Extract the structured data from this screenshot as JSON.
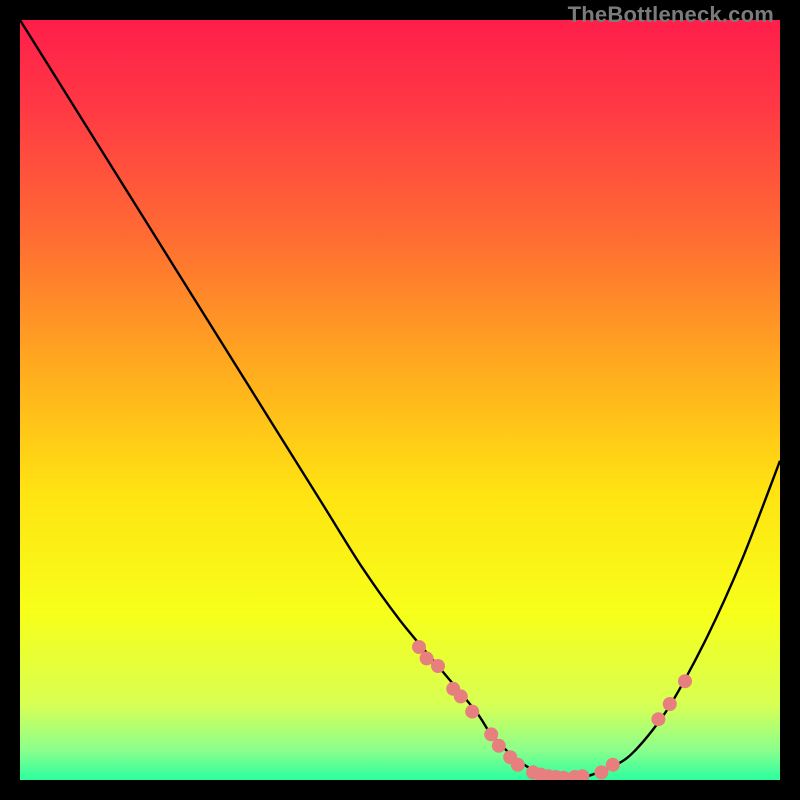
{
  "watermark": "TheBottleneck.com",
  "colors": {
    "gradient_stops": [
      {
        "offset": 0.0,
        "color": "#ff1e4b"
      },
      {
        "offset": 0.12,
        "color": "#ff3a44"
      },
      {
        "offset": 0.28,
        "color": "#ff6a33"
      },
      {
        "offset": 0.45,
        "color": "#ffa81f"
      },
      {
        "offset": 0.62,
        "color": "#ffe312"
      },
      {
        "offset": 0.78,
        "color": "#f7ff1a"
      },
      {
        "offset": 0.9,
        "color": "#d8ff53"
      },
      {
        "offset": 0.96,
        "color": "#8cff8c"
      },
      {
        "offset": 1.0,
        "color": "#2bff9e"
      }
    ],
    "curve": "#000000",
    "marker": "#e77f7e",
    "background": "#000000"
  },
  "chart_data": {
    "type": "line",
    "title": "",
    "xlabel": "",
    "ylabel": "",
    "xlim": [
      0,
      100
    ],
    "ylim": [
      0,
      100
    ],
    "grid": false,
    "legend": false,
    "series": [
      {
        "name": "curve",
        "x": [
          0,
          5,
          10,
          15,
          20,
          25,
          30,
          35,
          40,
          45,
          50,
          55,
          60,
          62,
          65,
          68,
          70,
          72,
          75,
          80,
          85,
          90,
          95,
          100
        ],
        "y": [
          100,
          92,
          84,
          76,
          68,
          60,
          52,
          44,
          36,
          28,
          21,
          15,
          9,
          6,
          3,
          1,
          0.4,
          0.3,
          0.6,
          3,
          9,
          18,
          29,
          42
        ]
      }
    ],
    "markers": [
      {
        "x": 52.5,
        "y": 17.5
      },
      {
        "x": 53.5,
        "y": 16.0
      },
      {
        "x": 55.0,
        "y": 15.0
      },
      {
        "x": 57.0,
        "y": 12.0
      },
      {
        "x": 58.0,
        "y": 11.0
      },
      {
        "x": 59.5,
        "y": 9.0
      },
      {
        "x": 62.0,
        "y": 6.0
      },
      {
        "x": 63.0,
        "y": 4.5
      },
      {
        "x": 64.5,
        "y": 3.0
      },
      {
        "x": 65.5,
        "y": 2.0
      },
      {
        "x": 67.5,
        "y": 1.0
      },
      {
        "x": 68.5,
        "y": 0.7
      },
      {
        "x": 69.5,
        "y": 0.5
      },
      {
        "x": 70.5,
        "y": 0.4
      },
      {
        "x": 71.5,
        "y": 0.3
      },
      {
        "x": 73.0,
        "y": 0.4
      },
      {
        "x": 74.0,
        "y": 0.5
      },
      {
        "x": 76.5,
        "y": 1.0
      },
      {
        "x": 78.0,
        "y": 2.0
      },
      {
        "x": 84.0,
        "y": 8.0
      },
      {
        "x": 85.5,
        "y": 10.0
      },
      {
        "x": 87.5,
        "y": 13.0
      }
    ],
    "marker_radius": 7
  }
}
